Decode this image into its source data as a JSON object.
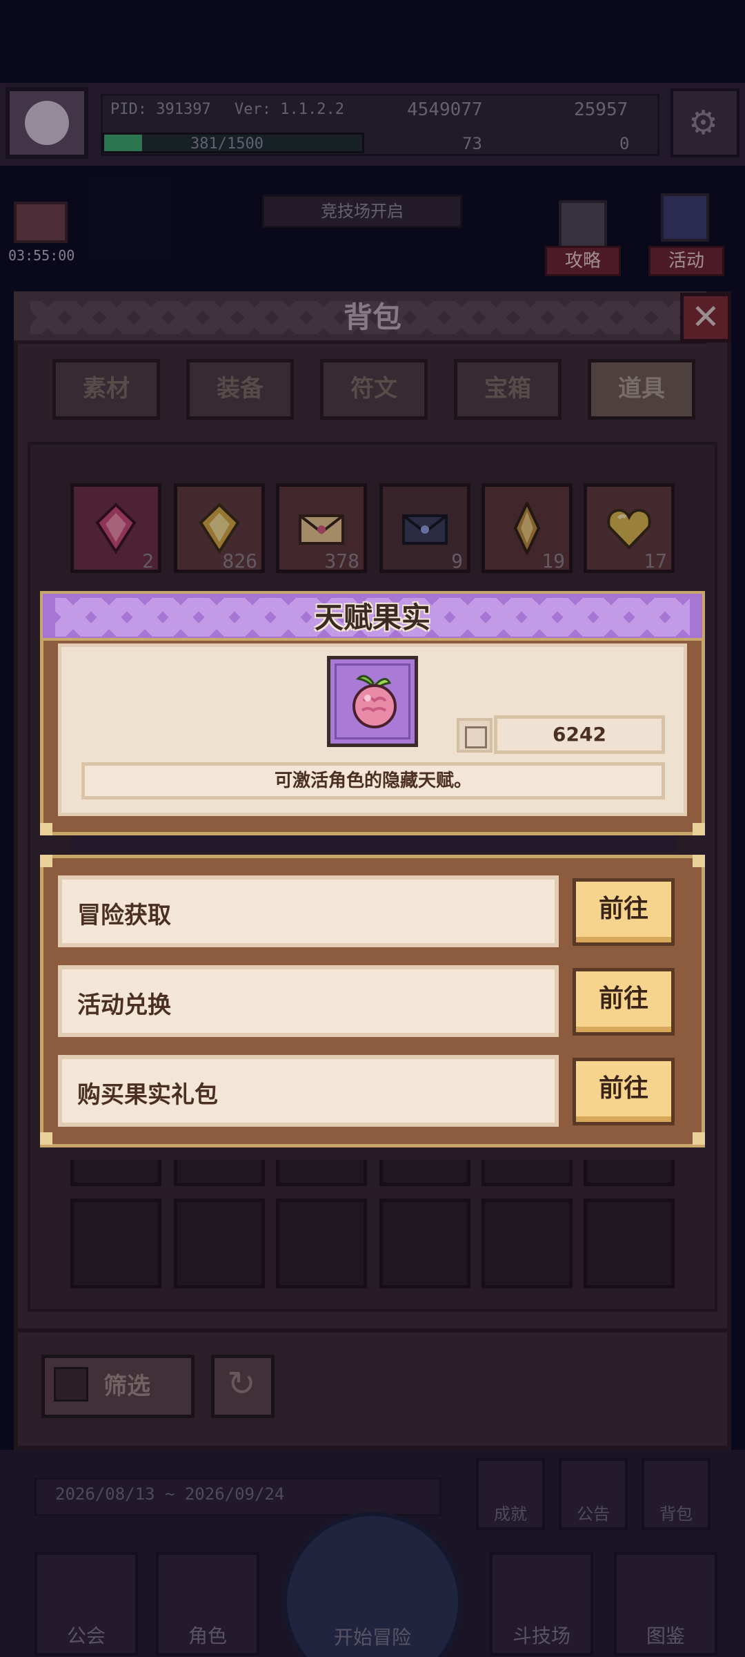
{
  "topbar": {
    "pid": "PID: 391397",
    "version": "Ver: 1.1.2.2",
    "gold": "4549077",
    "gems": "25957",
    "xp": "381/1500",
    "currency3": "73",
    "currency4": "0"
  },
  "side": {
    "timer": "03:55:00",
    "guide": "攻略",
    "activity": "活动",
    "banner": "竞技场开启"
  },
  "backpack": {
    "title": "背包",
    "tabs": [
      "素材",
      "装备",
      "符文",
      "宝箱",
      "道具"
    ],
    "active_tab": "道具",
    "items": [
      {
        "icon": "red-gem-icon",
        "count": "2"
      },
      {
        "icon": "gold-gem-icon",
        "count": "826"
      },
      {
        "icon": "pink-envelope-icon",
        "count": "378"
      },
      {
        "icon": "dark-envelope-icon",
        "count": "9"
      },
      {
        "icon": "amber-crystal-icon",
        "count": "19"
      },
      {
        "icon": "golden-heart-icon",
        "count": "17"
      }
    ],
    "filter_label": "筛选"
  },
  "item_popup": {
    "title": "天赋果实",
    "icon": "talent-fruit-icon",
    "count": "6242",
    "description": "可激活角色的隐藏天赋。"
  },
  "sources": [
    {
      "label": "冒险获取",
      "button": "前往"
    },
    {
      "label": "活动兑换",
      "button": "前往"
    },
    {
      "label": "购买果实礼包",
      "button": "前往"
    }
  ],
  "bottom": {
    "date_range": "2026/08/13 ~ 2026/09/24",
    "right_icons": [
      "成就",
      "公告",
      "背包"
    ],
    "nav": [
      "公会",
      "角色",
      "开始冒险",
      "斗技场",
      "图鉴"
    ]
  },
  "colors": {
    "popup_header": "#a776d4",
    "go_button": "#f6d48e",
    "popup_body": "#efe1cf"
  }
}
